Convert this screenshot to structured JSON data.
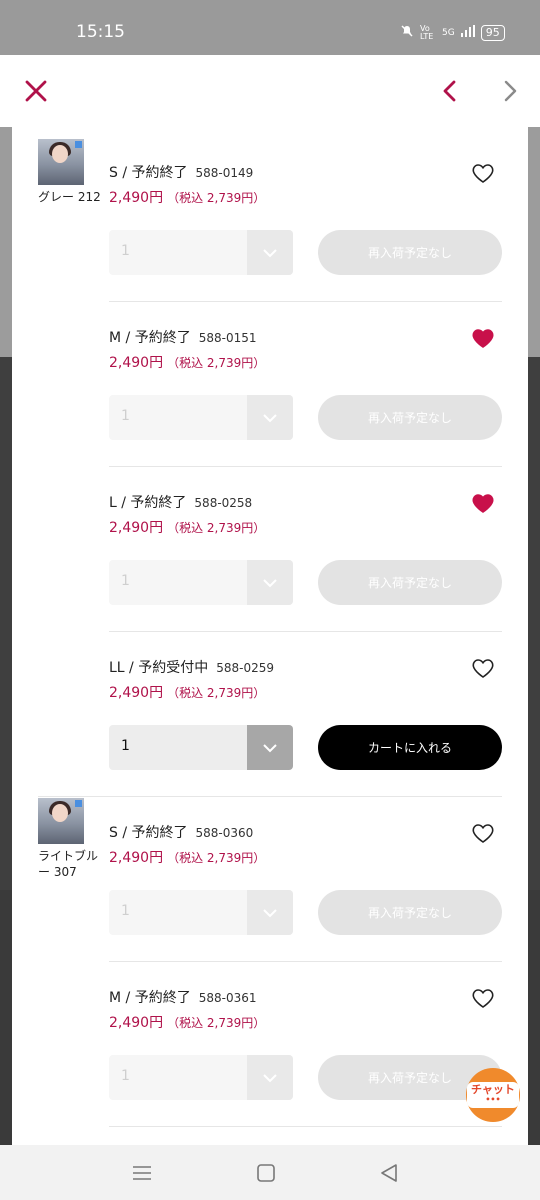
{
  "status_bar": {
    "time": "15:15",
    "battery": "95",
    "network": "5G",
    "volte": "Vo LTE"
  },
  "colors": {
    "accent": "#b0124a",
    "buy_button": "#000000",
    "disabled_button": "#e3e3e3",
    "chat": "#f08a2c"
  },
  "header": {
    "close_icon": "close-icon",
    "prev_icon": "chevron-left-icon",
    "next_icon": "chevron-right-icon"
  },
  "groups": [
    {
      "color_label": "グレー 212",
      "items": [
        {
          "size": "S / 予約終了",
          "code": "588-0149",
          "price": "2,490円",
          "tax": "（税込 2,739円）",
          "favorited": false,
          "qty": "1",
          "action": "再入荷予定なし",
          "available": false
        },
        {
          "size": "M / 予約終了",
          "code": "588-0151",
          "price": "2,490円",
          "tax": "（税込 2,739円）",
          "favorited": true,
          "qty": "1",
          "action": "再入荷予定なし",
          "available": false
        },
        {
          "size": "L / 予約終了",
          "code": "588-0258",
          "price": "2,490円",
          "tax": "（税込 2,739円）",
          "favorited": true,
          "qty": "1",
          "action": "再入荷予定なし",
          "available": false
        },
        {
          "size": "LL / 予約受付中",
          "code": "588-0259",
          "price": "2,490円",
          "tax": "（税込 2,739円）",
          "favorited": false,
          "qty": "1",
          "action": "カートに入れる",
          "available": true
        }
      ]
    },
    {
      "color_label": "ライトブルー 307",
      "items": [
        {
          "size": "S / 予約終了",
          "code": "588-0360",
          "price": "2,490円",
          "tax": "（税込 2,739円）",
          "favorited": false,
          "qty": "1",
          "action": "再入荷予定なし",
          "available": false
        },
        {
          "size": "M / 予約終了",
          "code": "588-0361",
          "price": "2,490円",
          "tax": "（税込 2,739円）",
          "favorited": false,
          "qty": "1",
          "action": "再入荷予定なし",
          "available": false
        }
      ]
    }
  ],
  "chat": {
    "label": "チャット",
    "dots": "•••"
  }
}
